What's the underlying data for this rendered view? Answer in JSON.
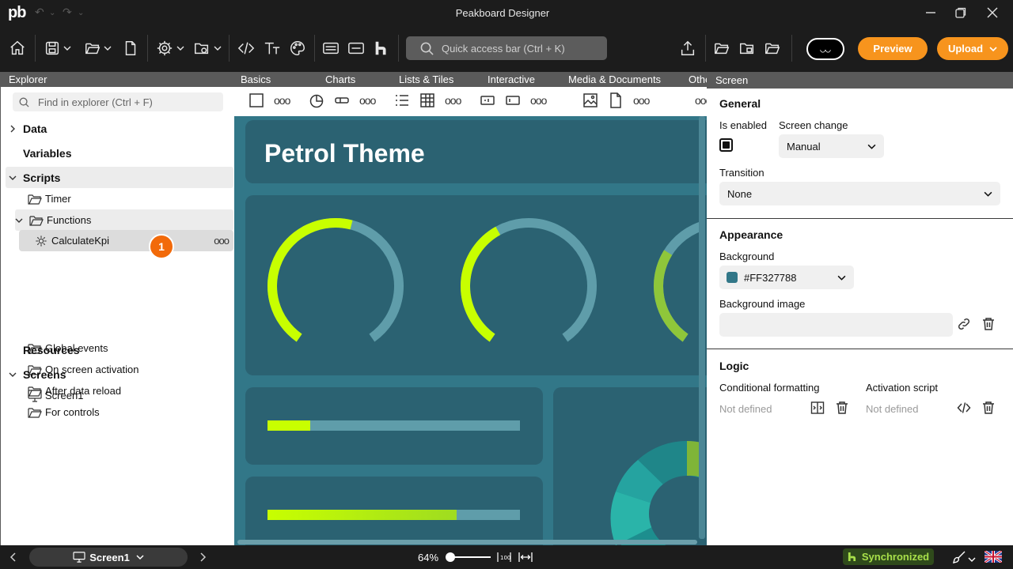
{
  "app": {
    "logo": "pb",
    "title": "Peakboard Designer"
  },
  "toolbar": {
    "quick_access_placeholder": "Quick access bar (Ctrl + K)",
    "avatar": "◡◡",
    "preview_label": "Preview",
    "upload_label": "Upload"
  },
  "explorer": {
    "title": "Explorer",
    "search_placeholder": "Find in explorer (Ctrl + F)",
    "data": "Data",
    "variables": "Variables",
    "scripts": "Scripts",
    "timer": "Timer",
    "functions": "Functions",
    "calculate_kpi": "CalculateKpi",
    "global_events": "Global events",
    "on_screen_activation": "On screen activation",
    "after_data_reload": "After data reload",
    "for_controls": "For controls",
    "resources": "Resources",
    "screens": "Screens",
    "screen1": "Screen1",
    "badge": "1",
    "more": "ooo"
  },
  "tabs": [
    "Basics",
    "Charts",
    "Lists & Tiles",
    "Interactive",
    "Media & Documents",
    "Othe"
  ],
  "canvas": {
    "title": "Petrol Theme",
    "background": "#327788",
    "gauges": [
      0.55,
      0.4,
      0.3
    ],
    "bars": [
      0.17,
      0.75
    ]
  },
  "props": {
    "header": "Screen",
    "general": "General",
    "is_enabled": "Is enabled",
    "screen_change": "Screen change",
    "screen_change_value": "Manual",
    "transition": "Transition",
    "transition_value": "None",
    "appearance": "Appearance",
    "background": "Background",
    "background_value": "#FF327788",
    "background_image": "Background image",
    "logic": "Logic",
    "conditional_formatting": "Conditional formatting",
    "conditional_formatting_value": "Not defined",
    "activation_script": "Activation script",
    "activation_script_value": "Not defined"
  },
  "status": {
    "screen": "Screen1",
    "zoom": "64%",
    "zoom_fraction": 0.1,
    "sync": "Synchronized"
  },
  "colors": {
    "accent": "#f7941d",
    "lime": "#c8ff00",
    "petrol": "#327788",
    "tile": "#2b6272"
  }
}
